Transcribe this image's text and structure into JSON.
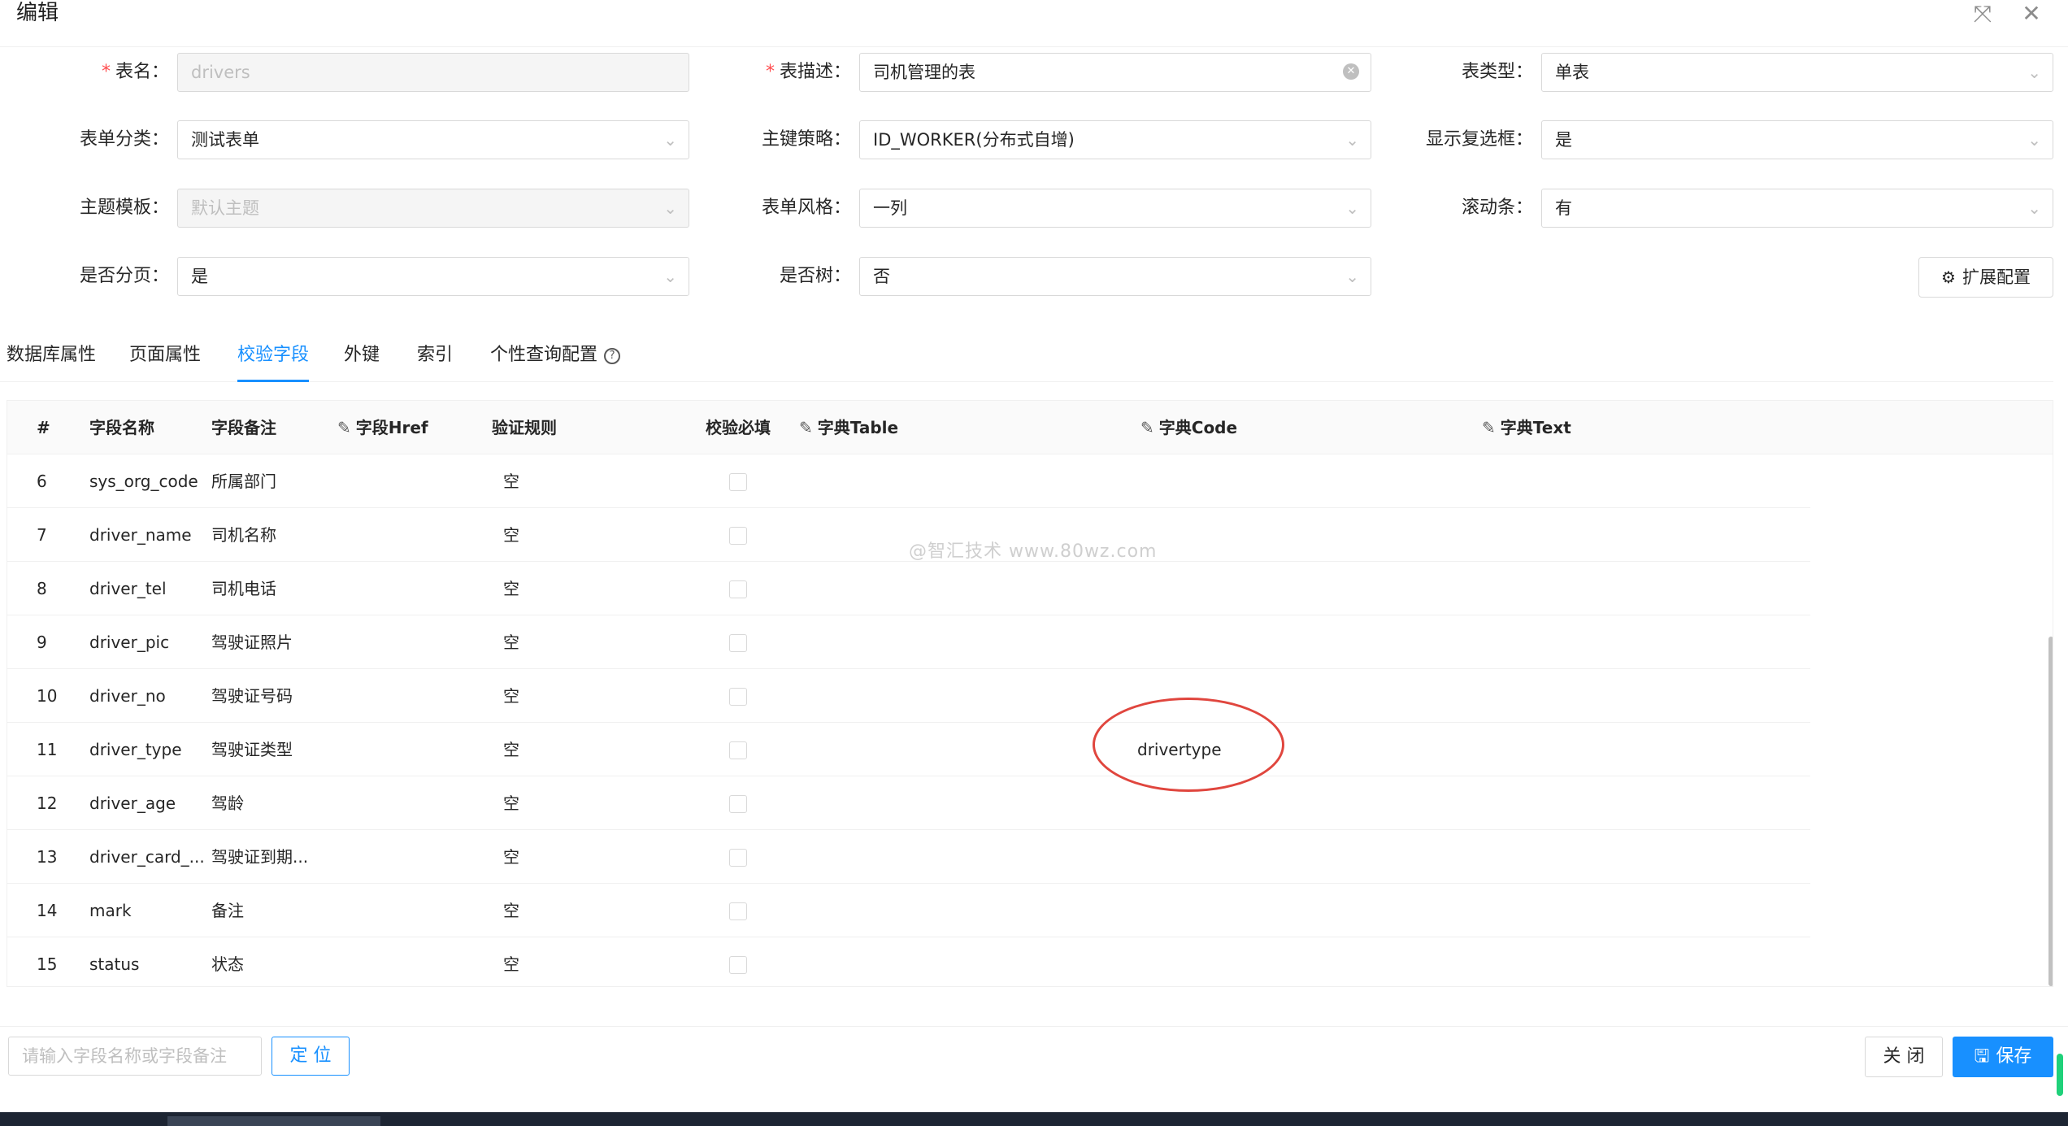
{
  "dialog": {
    "title": "编辑"
  },
  "form": {
    "table_name": {
      "label": "表名",
      "value": "drivers",
      "required": true
    },
    "table_desc": {
      "label": "表描述",
      "value": "司机管理的表",
      "required": true
    },
    "table_type": {
      "label": "表类型",
      "value": "单表"
    },
    "form_category": {
      "label": "表单分类",
      "value": "测试表单"
    },
    "pk_strategy": {
      "label": "主键策略",
      "value": "ID_WORKER(分布式自增)"
    },
    "show_checkbox": {
      "label": "显示复选框",
      "value": "是"
    },
    "theme_template": {
      "label": "主题模板",
      "value": "默认主题"
    },
    "form_style": {
      "label": "表单风格",
      "value": "一列"
    },
    "scrollbar": {
      "label": "滚动条",
      "value": "有"
    },
    "paging": {
      "label": "是否分页",
      "value": "是"
    },
    "is_tree": {
      "label": "是否树",
      "value": "否"
    },
    "label_suffix": "：",
    "ext_config_label": "扩展配置"
  },
  "tabs": [
    {
      "label": "数据库属性"
    },
    {
      "label": "页面属性"
    },
    {
      "label": "校验字段"
    },
    {
      "label": "外键"
    },
    {
      "label": "索引"
    },
    {
      "label": "个性查询配置"
    }
  ],
  "table": {
    "columns": [
      "#",
      "字段名称",
      "字段备注",
      "字段Href",
      "验证规则",
      "校验必填",
      "字典Table",
      "字典Code",
      "字典Text"
    ],
    "rows": [
      {
        "index": "6",
        "name": "sys_org_code",
        "remark": "所属部门",
        "rule": "空",
        "dict_code": ""
      },
      {
        "index": "7",
        "name": "driver_name",
        "remark": "司机名称",
        "rule": "空",
        "dict_code": ""
      },
      {
        "index": "8",
        "name": "driver_tel",
        "remark": "司机电话",
        "rule": "空",
        "dict_code": ""
      },
      {
        "index": "9",
        "name": "driver_pic",
        "remark": "驾驶证照片",
        "rule": "空",
        "dict_code": ""
      },
      {
        "index": "10",
        "name": "driver_no",
        "remark": "驾驶证号码",
        "rule": "空",
        "dict_code": ""
      },
      {
        "index": "11",
        "name": "driver_type",
        "remark": "驾驶证类型",
        "rule": "空",
        "dict_code": "drivertype"
      },
      {
        "index": "12",
        "name": "driver_age",
        "remark": "驾龄",
        "rule": "空",
        "dict_code": ""
      },
      {
        "index": "13",
        "name": "driver_card_...",
        "remark": "驾驶证到期...",
        "rule": "空",
        "dict_code": ""
      },
      {
        "index": "14",
        "name": "mark",
        "remark": "备注",
        "rule": "空",
        "dict_code": ""
      },
      {
        "index": "15",
        "name": "status",
        "remark": "状态",
        "rule": "空",
        "dict_code": ""
      }
    ]
  },
  "watermark": "@智汇技术 www.80wz.com",
  "footer": {
    "locate_placeholder": "请输入字段名称或字段备注",
    "locate_label": "定 位",
    "close_label": "关 闭",
    "save_label": "保存"
  },
  "colors": {
    "primary": "#1890ff",
    "required": "#ff4d4f",
    "annotation": "#e0463e"
  }
}
